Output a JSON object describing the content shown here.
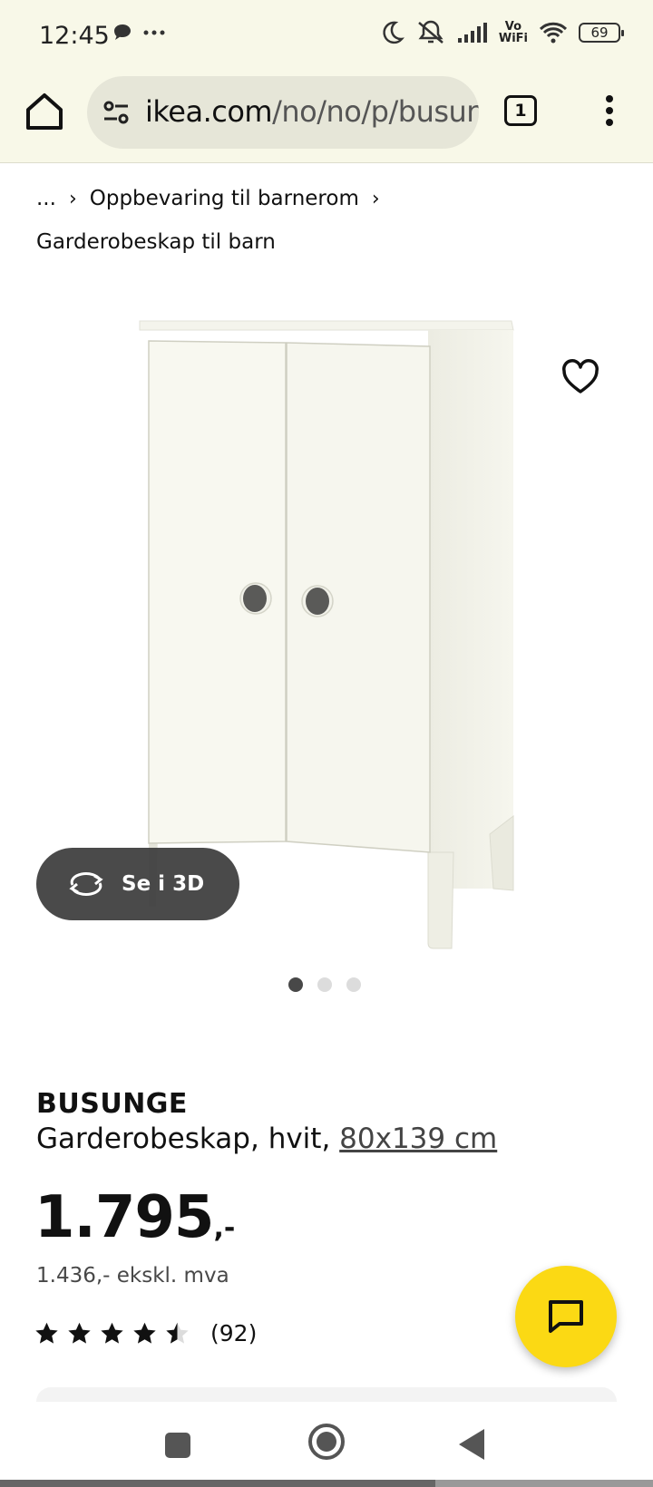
{
  "status_bar": {
    "time": "12:45",
    "battery": "69",
    "vowifi_top": "Vo",
    "vowifi_bottom": "WiFi",
    "icons": [
      "chat-bubble-icon",
      "more-dots-icon",
      "moon-icon",
      "mute-icon",
      "signal-icon",
      "wifi-icon",
      "battery-icon"
    ]
  },
  "browser": {
    "url_domain": "ikea.com",
    "url_path": "/no/no/p/busung",
    "tab_count": "1"
  },
  "breadcrumb": {
    "ellipsis": "...",
    "parent": "Oppbevaring til barnerom",
    "current": "Garderobeskap til barn"
  },
  "gallery": {
    "view_3d_label": "Se i 3D",
    "dot_count": 3,
    "active_dot": 0
  },
  "product": {
    "brand": "BUSUNGE",
    "description": "Garderobeskap, hvit,",
    "size": "80x139 cm",
    "price": "1.795",
    "price_suffix": ",-",
    "price_ex_vat": "1.436,- ekskl. mva",
    "rating": 4.5,
    "rating_max": 5,
    "review_count": "(92)"
  },
  "colors": {
    "status_bg": "#f8f8e8",
    "chat_accent": "#fbd914",
    "dark_pill": "#3c3c3c"
  }
}
